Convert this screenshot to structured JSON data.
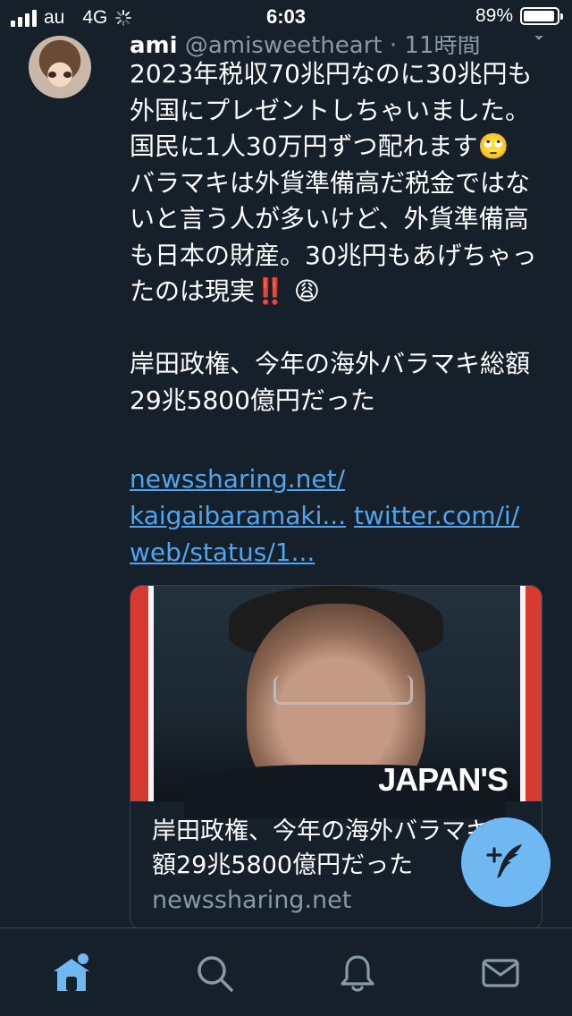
{
  "status_bar": {
    "carrier": "au",
    "network": "4G",
    "time": "6:03",
    "battery_percent": "89%",
    "signal_bars": 4,
    "battery_level": 0.89
  },
  "tweet": {
    "author_name": "ami",
    "author_handle": "@amisweetheart",
    "time_ago": "11時間",
    "text_part1": "2023年税収70兆円なのに30兆円も外国にプレゼントしちゃいました。国民に1人30万円ずつ配れます",
    "emoji1": "🙄",
    "text_part2": "\nバラマキは外貨準備高だ税金ではないと言う人が多いけど、外貨準備高も日本の財産。30兆円もあげちゃったのは現実",
    "emoji2": "‼️",
    "emoji3": "😩",
    "text_part3": "\n\n岸田政権、今年の海外バラマキ総額29兆5800億円だった",
    "link1": "newssharing.net/\nkaigaibaramaki...",
    "link2": "twitter.com/i/\nweb/status/1..."
  },
  "card": {
    "image_caption": "JAPAN'S",
    "title": "岸田政権、今年の海外バラマキ総額29兆5800億円だった",
    "domain": "newssharing.net"
  },
  "icons": {
    "fab": "compose-tweet-icon",
    "home": "home-icon",
    "search": "search-icon",
    "notifications": "bell-icon",
    "messages": "mail-icon"
  },
  "colors": {
    "background": "#15202b",
    "link": "#4fa6ee",
    "accent": "#6fb8f2",
    "muted": "#8899a6",
    "tab_active": "#6fb8f2"
  }
}
